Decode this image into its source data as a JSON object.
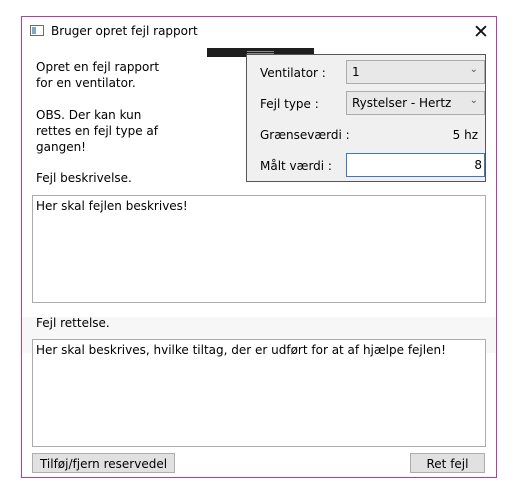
{
  "window": {
    "title": "Bruger opret fejl rapport",
    "close_label": "✕"
  },
  "intro": {
    "line1": "Opret en fejl rapport\nfor en ventilator.",
    "line2": "OBS. Der kan kun\nrettes en fejl type af\ngangen!",
    "description_heading": "Fejl beskrivelse.",
    "correction_heading": "Fejl rettelse."
  },
  "panel": {
    "ventilator_label": "Ventilator :",
    "ventilator_value": "1",
    "fault_type_label": "Fejl type :",
    "fault_type_value": "Rystelser - Hertz",
    "limit_label": "Grænseværdi :",
    "limit_value": "5 hz",
    "measured_label": "Målt værdi :",
    "measured_value": "8"
  },
  "description_text": "Her skal fejlen beskrives!",
  "correction_text": "Her skal beskrives, hvilke tiltag, der er udført for at af hjælpe fejlen!",
  "buttons": {
    "spare_part": "Tilføj/fjern reservedel",
    "fix": "Ret fejl"
  },
  "icons": {
    "app": "window-icon",
    "close": "close-icon",
    "dropdown": "chevron-down-icon"
  }
}
